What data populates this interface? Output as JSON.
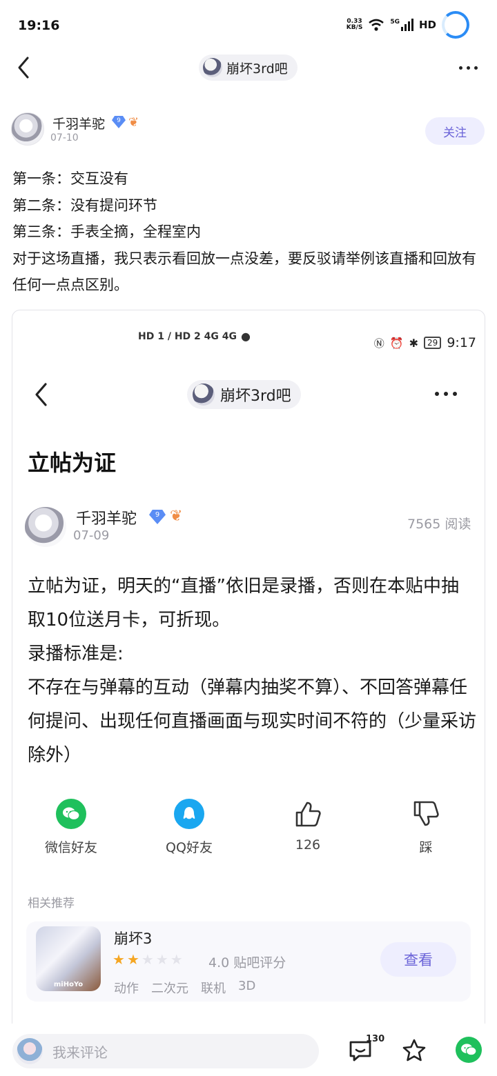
{
  "status_bar": {
    "time": "19:16",
    "net_speed_value": "0.33",
    "net_speed_unit": "KB/S",
    "signal_label": "5G",
    "hd_label": "HD"
  },
  "nav": {
    "forum_name": "崩坏3rd吧"
  },
  "post": {
    "author": "千羽羊驼",
    "level": "9",
    "date": "07-10",
    "follow_label": "关注",
    "lines": [
      "第一条：交互没有",
      "第二条：没有提问环节",
      "第三条：手表全摘，全程室内",
      "对于这场直播，我只表示看回放一点没差，要反驳请举例该直播和回放有任何一点点区别。"
    ]
  },
  "embedded": {
    "status_left": "HD 1 / HD 2  4G  4G",
    "battery": "29",
    "time": "9:17",
    "forum_name": "崩坏3rd吧",
    "title": "立帖为证",
    "author": "千羽羊驼",
    "level": "9",
    "date": "07-09",
    "reads": "7565 阅读",
    "body_lines": [
      "立帖为证，明天的“直播”依旧是录播，否则在本贴中抽取10位送月卡，可折现。",
      "录播标准是:",
      "不存在与弹幕的互动（弹幕内抽奖不算）、不回答弹幕任何提问、出现任何直播画面与现实时间不符的（少量采访除外）"
    ],
    "actions": {
      "wechat": "微信好友",
      "qq": "QQ好友",
      "likes": "126",
      "dislike": "踩"
    },
    "related_label": "相关推荐",
    "game": {
      "name": "崩坏3",
      "icon_text": "miHoYo",
      "rating": 2,
      "rating_max": 5,
      "score_text": "4.0 贴吧评分",
      "tags": [
        "动作",
        "二次元",
        "联机",
        "3D"
      ],
      "view_label": "查看"
    }
  },
  "bottom_bar": {
    "comment_placeholder": "我来评论",
    "comment_count": "130"
  },
  "colors": {
    "accent": "#6a63d8",
    "accent_bg": "#eeeefe",
    "wechat_green": "#1fc05c",
    "qq_blue": "#1aa7f0",
    "star": "#f5a623"
  }
}
